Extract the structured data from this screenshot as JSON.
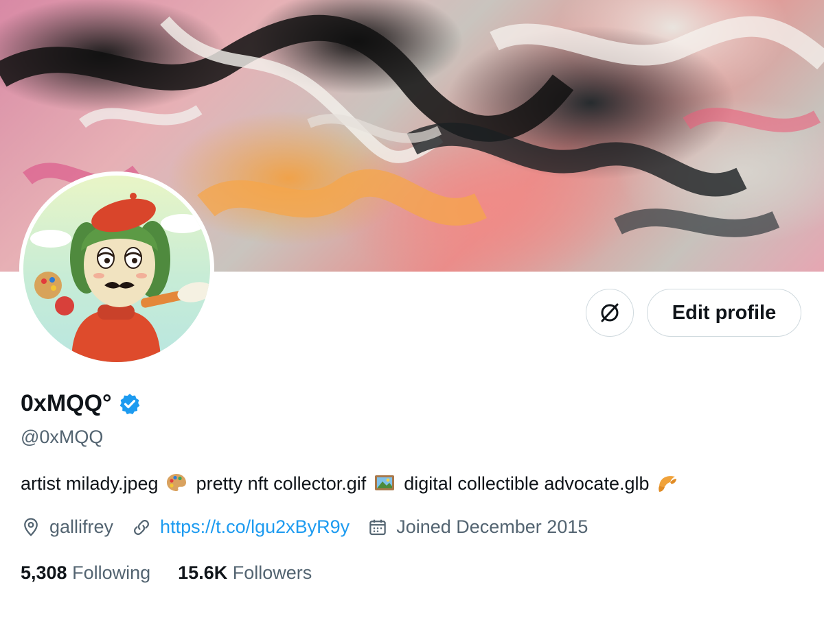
{
  "colors": {
    "accent": "#1d9bf0",
    "text": "#0f1419",
    "muted": "#536471",
    "border": "#cfd9de"
  },
  "profile": {
    "display_name": "0xMQQ°",
    "handle": "@0xMQQ",
    "bio_parts": [
      "artist milady.jpeg",
      "pretty nft collector.gif",
      "digital collectible advocate.glb"
    ],
    "bio_emojis": [
      "palette-emoji",
      "framed-picture-emoji",
      "croissant-emoji"
    ],
    "location": "gallifrey",
    "website": "https://t.co/lgu2xByR9y",
    "joined": "Joined December 2015"
  },
  "actions": {
    "edit_profile": "Edit profile",
    "secondary_icon": "circle-slash-icon"
  },
  "stats": {
    "following_count": "5,308",
    "following_label": "Following",
    "followers_count": "15.6K",
    "followers_label": "Followers"
  }
}
